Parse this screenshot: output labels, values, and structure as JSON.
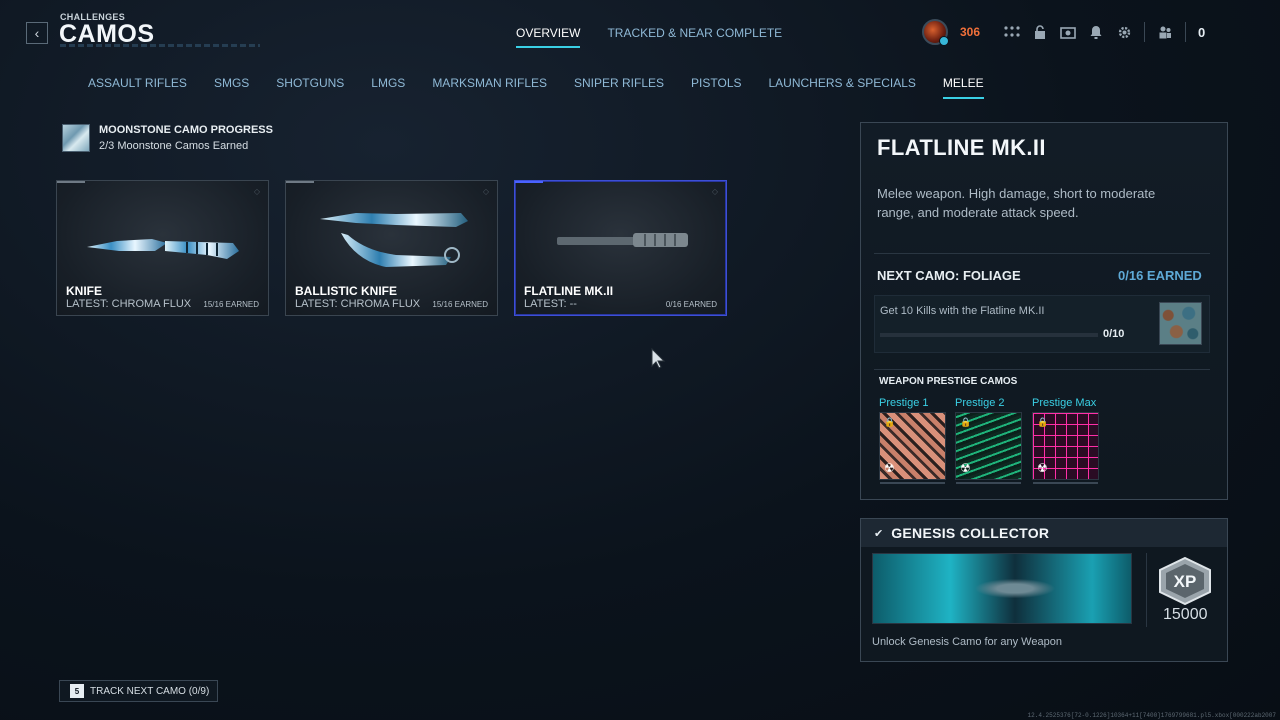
{
  "header": {
    "breadcrumb": "CHALLENGES",
    "title": "CAMOS",
    "tabs": [
      {
        "label": "OVERVIEW",
        "active": true
      },
      {
        "label": "TRACKED & NEAR COMPLETE",
        "active": false
      }
    ]
  },
  "hud": {
    "currency": "306",
    "party_count": "0",
    "icons": [
      "grid-icon",
      "lock-icon",
      "camera-icon",
      "bell-icon",
      "gear-icon",
      "party-icon"
    ]
  },
  "categories": [
    {
      "label": "ASSAULT RIFLES",
      "active": false
    },
    {
      "label": "SMGS",
      "active": false
    },
    {
      "label": "SHOTGUNS",
      "active": false
    },
    {
      "label": "LMGS",
      "active": false
    },
    {
      "label": "MARKSMAN RIFLES",
      "active": false
    },
    {
      "label": "SNIPER RIFLES",
      "active": false
    },
    {
      "label": "PISTOLS",
      "active": false
    },
    {
      "label": "LAUNCHERS & SPECIALS",
      "active": false
    },
    {
      "label": "MELEE",
      "active": true
    }
  ],
  "moonstone": {
    "title": "MOONSTONE CAMO PROGRESS",
    "subtitle": "2/3 Moonstone Camos Earned"
  },
  "weapons": [
    {
      "name": "KNIFE",
      "latest": "LATEST: CHROMA FLUX",
      "earned": "15/16 EARNED",
      "progress": 0.9375
    },
    {
      "name": "BALLISTIC KNIFE",
      "latest": "LATEST: CHROMA FLUX",
      "earned": "15/16 EARNED",
      "progress": 0.9375
    },
    {
      "name": "FLATLINE MK.II",
      "latest": "LATEST: --",
      "earned": "0/16 EARNED",
      "progress": 0,
      "selected": true
    }
  ],
  "detail": {
    "title": "FLATLINE MK.II",
    "description": "Melee weapon. High damage, short to moderate range, and moderate attack speed.",
    "next_camo_label": "NEXT CAMO: FOLIAGE",
    "next_camo_earned": "0/16 EARNED",
    "challenge_text": "Get 10 Kills with the Flatline MK.II",
    "challenge_count": "0/10",
    "challenge_progress": 0,
    "prestige_label": "WEAPON PRESTIGE CAMOS",
    "prestige": [
      {
        "name": "Prestige 1",
        "color": "#d9907a"
      },
      {
        "name": "Prestige 2",
        "color": "#1fb37a"
      },
      {
        "name": "Prestige Max",
        "color": "#ff2fa8"
      }
    ]
  },
  "genesis": {
    "title": "GENESIS COLLECTOR",
    "xp_label": "XP",
    "xp_value": "15000",
    "description": "Unlock Genesis Camo for any Weapon"
  },
  "track": {
    "key": "5",
    "label": "TRACK NEXT CAMO (0/9)"
  },
  "build_string": "12.4.2525376[72-0.1226]10364+11[7400]1769799681.pl5.xbox[000222ab2007"
}
